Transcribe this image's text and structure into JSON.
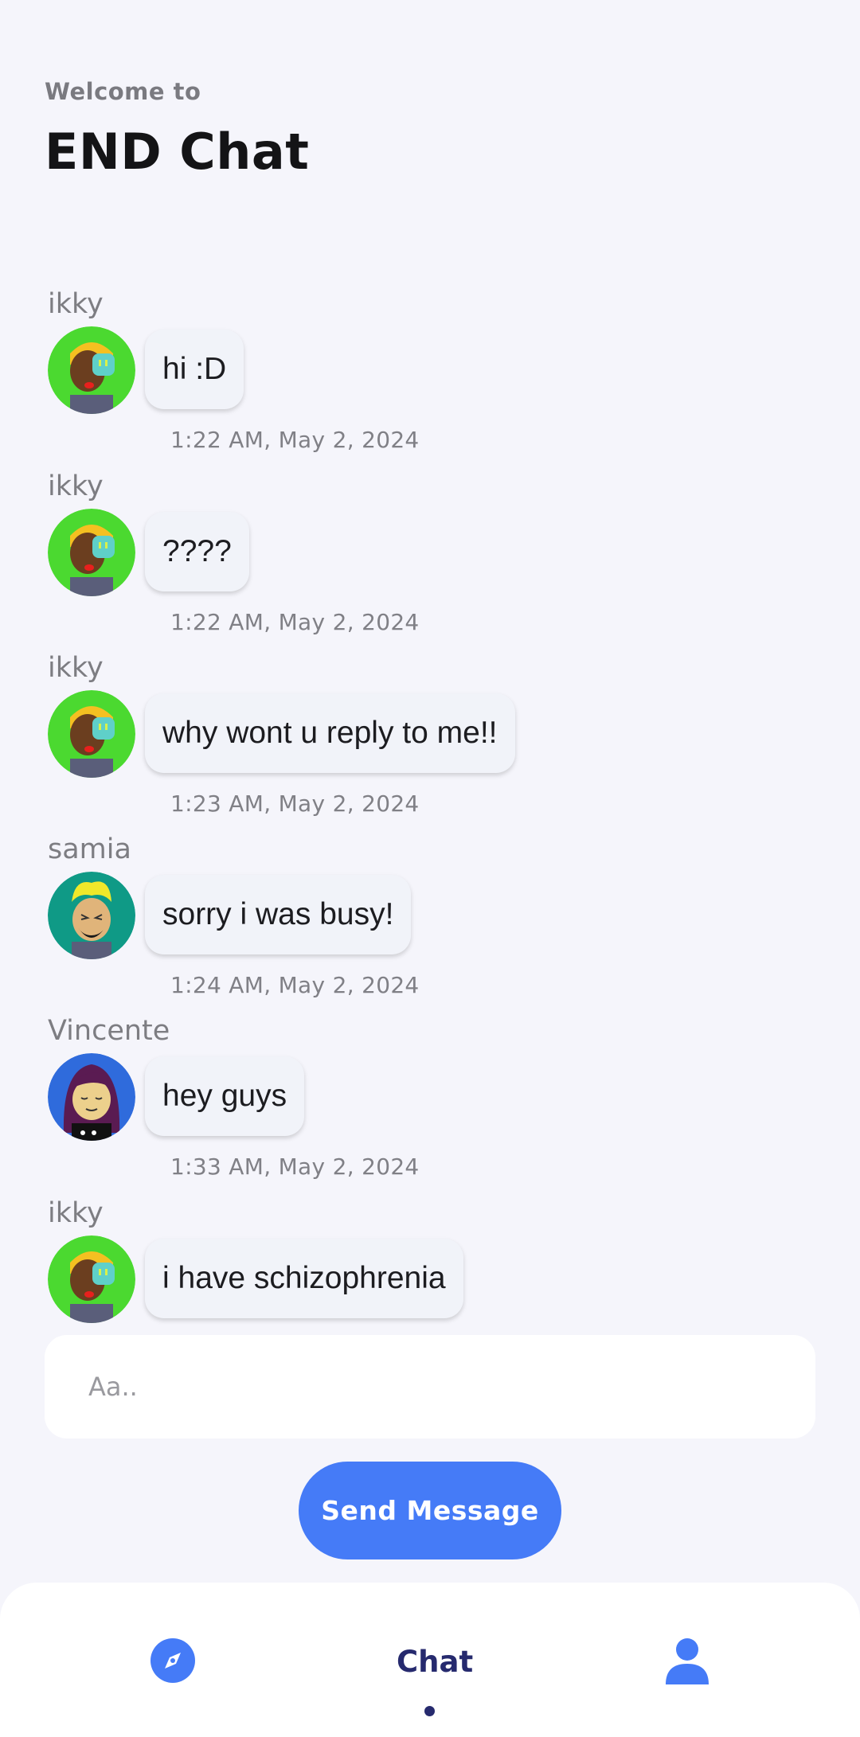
{
  "header": {
    "welcome": "Welcome to",
    "title": "END Chat"
  },
  "messages": [
    {
      "sender": "ikky",
      "text": "hi :D",
      "time": "1:22 AM, May 2, 2024",
      "avatar": "avatar-ikky"
    },
    {
      "sender": "ikky",
      "text": "????",
      "time": "1:22 AM, May 2, 2024",
      "avatar": "avatar-ikky"
    },
    {
      "sender": "ikky",
      "text": "why wont u reply to me!!",
      "time": "1:23 AM, May 2, 2024",
      "avatar": "avatar-ikky"
    },
    {
      "sender": "samia",
      "text": "sorry i was busy!",
      "time": "1:24 AM, May 2, 2024",
      "avatar": "avatar-samia"
    },
    {
      "sender": "Vincente",
      "text": "hey guys",
      "time": "1:33 AM, May 2, 2024",
      "avatar": "avatar-vincente"
    },
    {
      "sender": "ikky",
      "text": "i have schizophrenia",
      "time": "",
      "avatar": "avatar-ikky"
    }
  ],
  "composer": {
    "placeholder": "Aa..",
    "send_label": "Send Message"
  },
  "nav": {
    "explore_icon": "compass-icon",
    "chat_label": "Chat",
    "profile_icon": "person-icon",
    "active": "Chat"
  },
  "colors": {
    "background": "#f5f5fb",
    "accent": "#457bf7",
    "nav_active": "#262a6e",
    "bubble": "#f1f3f9"
  }
}
